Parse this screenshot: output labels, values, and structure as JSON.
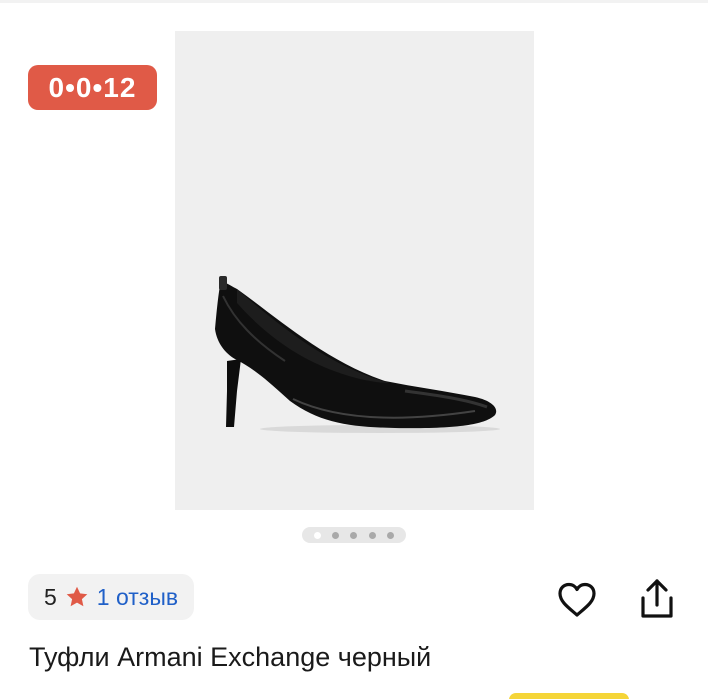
{
  "timer": {
    "text": "0•0•12",
    "color": "#e05a47"
  },
  "product": {
    "image_icon": "black-patent-pump-shoe",
    "title": "Туфли Armani Exchange черный"
  },
  "carousel": {
    "total": 5,
    "active_index": 1
  },
  "rating": {
    "value": "5",
    "star_icon": "star-icon",
    "star_color": "#e05a47",
    "reviews_label": "1 отзыв"
  },
  "actions": {
    "favorite_icon": "heart-outline-icon",
    "share_icon": "share-icon"
  },
  "colors": {
    "accent_yellow": "#f5d538",
    "link_blue": "#2060c8"
  }
}
